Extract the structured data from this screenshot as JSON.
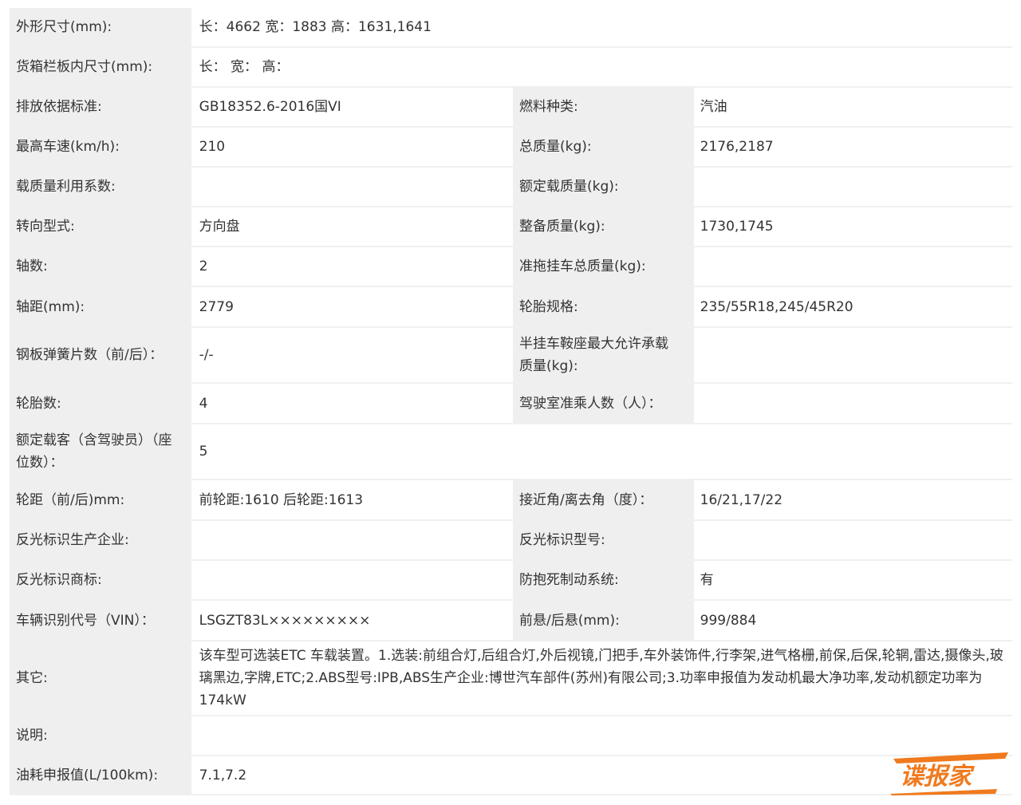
{
  "rows": [
    {
      "type": "full",
      "label": "外形尺寸(mm):",
      "value": "长：4662 宽：1883 高：1631,1641"
    },
    {
      "type": "full",
      "label": "货箱栏板内尺寸(mm):",
      "value": "长：  宽：  高："
    },
    {
      "type": "pair",
      "l1": "排放依据标准:",
      "v1": "GB18352.6-2016国VI",
      "l2": "燃料种类:",
      "v2": "汽油"
    },
    {
      "type": "pair",
      "l1": "最高车速(km/h):",
      "v1": "210",
      "l2": "总质量(kg):",
      "v2": "2176,2187"
    },
    {
      "type": "pair",
      "l1": "载质量利用系数:",
      "v1": "",
      "l2": "额定载质量(kg):",
      "v2": ""
    },
    {
      "type": "pair",
      "l1": "转向型式:",
      "v1": "方向盘",
      "l2": "整备质量(kg):",
      "v2": "1730,1745"
    },
    {
      "type": "pair",
      "l1": "轴数:",
      "v1": "2",
      "l2": "准拖挂车总质量(kg):",
      "v2": ""
    },
    {
      "type": "pair",
      "l1": "轴距(mm):",
      "v1": "2779",
      "l2": "轮胎规格:",
      "v2": "235/55R18,245/45R20"
    },
    {
      "type": "pair",
      "l1": "钢板弹簧片数（前/后）：",
      "v1": "-/-",
      "l2": "半挂车鞍座最大允许承载质量(kg):",
      "v2": ""
    },
    {
      "type": "pair",
      "l1": "轮胎数:",
      "v1": "4",
      "l2": "驾驶室准乘人数（人）：",
      "v2": ""
    },
    {
      "type": "full",
      "label": "额定载客（含驾驶员）（座位数）：",
      "value": "5"
    },
    {
      "type": "pair",
      "l1": "轮距（前/后)mm:",
      "v1": "前轮距:1610 后轮距:1613",
      "l2": "接近角/离去角（度）：",
      "v2": "16/21,17/22"
    },
    {
      "type": "pair",
      "l1": "反光标识生产企业:",
      "v1": "",
      "l2": "反光标识型号:",
      "v2": ""
    },
    {
      "type": "pair",
      "l1": "反光标识商标:",
      "v1": "",
      "l2": "防抱死制动系统:",
      "v2": "有"
    },
    {
      "type": "pair",
      "l1": "车辆识别代号（VIN）：",
      "v1": "LSGZT83L×××××××××",
      "l2": "前悬/后悬(mm):",
      "v2": "999/884"
    },
    {
      "type": "full",
      "label": "其它:",
      "value": "该车型可选装ETC 车载装置。1.选装:前组合灯,后组合灯,外后视镜,门把手,车外装饰件,行李架,进气格栅,前保,后保,轮辋,雷达,摄像头,玻璃黑边,字牌,ETC;2.ABS型号:IPB,ABS生产企业:博世汽车部件(苏州)有限公司;3.功率申报值为发动机最大净功率,发动机额定功率为174kW"
    },
    {
      "type": "full",
      "label": "说明:",
      "value": ""
    },
    {
      "type": "full",
      "label": "油耗申报值(L/100km):",
      "value": "7.1,7.2"
    }
  ],
  "watermark": {
    "text": "谍报家",
    "color": "#f07a1e"
  }
}
